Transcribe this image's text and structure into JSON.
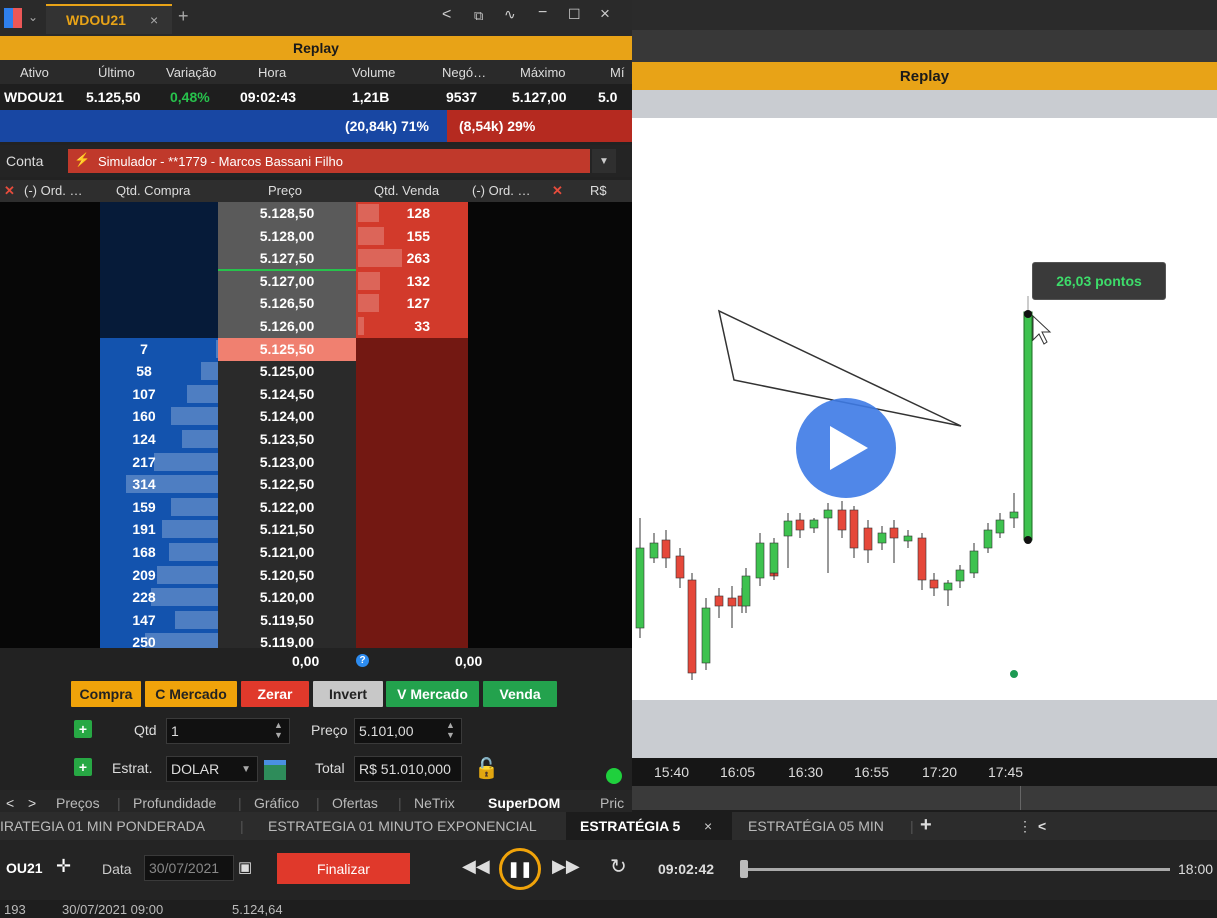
{
  "window": {
    "tab_title": "WDOU21",
    "replay_label": "Replay"
  },
  "quote": {
    "headers": [
      "Ativo",
      "Último",
      "Variação",
      "Hora",
      "Volume",
      "Negó…",
      "Máximo",
      "Mí"
    ],
    "values": [
      "WDOU21",
      "5.125,50",
      "0,48%",
      "09:02:43",
      "1,21B",
      "9537",
      "5.127,00",
      "5.0"
    ],
    "variation_color": "#27c24c"
  },
  "ratio": {
    "buy": "(20,84k) 71%",
    "sell": "(8,54k) 29%"
  },
  "account": {
    "label": "Conta",
    "value": "Simulador - **1779 - Marcos Bassani Filho"
  },
  "book": {
    "headers": [
      "(-) Ord. …",
      "Qtd. Compra",
      "Preço",
      "Qtd. Venda",
      "(-) Ord. …",
      "R$"
    ],
    "asks": [
      {
        "price": "5.128,50",
        "qty": "128"
      },
      {
        "price": "5.128,00",
        "qty": "155"
      },
      {
        "price": "5.127,50",
        "qty": "263"
      },
      {
        "price": "5.127,00",
        "qty": "132"
      },
      {
        "price": "5.126,50",
        "qty": "127"
      },
      {
        "price": "5.126,00",
        "qty": "33"
      }
    ],
    "bids": [
      {
        "price": "5.125,50",
        "qty": "7"
      },
      {
        "price": "5.125,00",
        "qty": "58"
      },
      {
        "price": "5.124,50",
        "qty": "107"
      },
      {
        "price": "5.124,00",
        "qty": "160"
      },
      {
        "price": "5.123,50",
        "qty": "124"
      },
      {
        "price": "5.123,00",
        "qty": "217"
      },
      {
        "price": "5.122,50",
        "qty": "314"
      },
      {
        "price": "5.122,00",
        "qty": "159"
      },
      {
        "price": "5.121,50",
        "qty": "191"
      },
      {
        "price": "5.121,00",
        "qty": "168"
      },
      {
        "price": "5.120,50",
        "qty": "209"
      },
      {
        "price": "5.120,00",
        "qty": "228"
      },
      {
        "price": "5.119,50",
        "qty": "147"
      },
      {
        "price": "5.119,00",
        "qty": "250"
      }
    ],
    "total_buy": "0,00",
    "total_sell": "0,00"
  },
  "buttons": {
    "compra": "Compra",
    "c_mercado": "C Mercado",
    "zerar": "Zerar",
    "invert": "Invert",
    "v_mercado": "V Mercado",
    "venda": "Venda"
  },
  "order": {
    "qtd_label": "Qtd",
    "qtd_value": "1",
    "preco_label": "Preço",
    "preco_value": "5.101,00",
    "estrat_label": "Estrat.",
    "estrat_value": "DOLAR",
    "total_label": "Total",
    "total_value": "R$ 51.010,000"
  },
  "tabs": [
    "Preços",
    "Profundidade",
    "Gráfico",
    "Ofertas",
    "NeTrix",
    "SuperDOM",
    "Pric"
  ],
  "active_tab": "SuperDOM",
  "chart": {
    "tooltip": "26,03 pontos",
    "time_labels": [
      "15:40",
      "16:05",
      "16:30",
      "16:55",
      "17:20",
      "17:45"
    ]
  },
  "strategies": [
    "IRATEGIA 01 MIN PONDERADA",
    "ESTRATEGIA 01 MINUTO EXPONENCIAL",
    "ESTRATÉGIA 5",
    "ESTRATÉGIA 05 MIN"
  ],
  "replay": {
    "symbol": "OU21",
    "date_label": "Data",
    "date_value": "30/07/2021",
    "finalize": "Finalizar",
    "time": "09:02:42",
    "end_time": "18:00"
  },
  "status": {
    "col1": "193",
    "col2": "30/07/2021 09:00",
    "col3": "5.124,64"
  }
}
